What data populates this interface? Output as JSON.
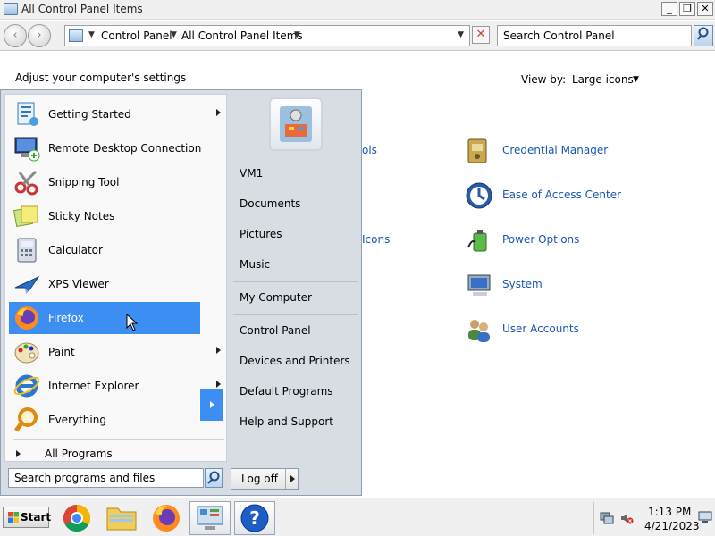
{
  "window": {
    "title": "All Control Panel Items",
    "min_glyph": "_",
    "max_glyph": "❐",
    "close_glyph": "✕"
  },
  "address_bar": {
    "back_glyph": "‹",
    "forward_glyph": "›",
    "breadcrumbs": [
      "Control Panel",
      "All Control Panel Items"
    ],
    "refresh_glyph": "✕",
    "search_placeholder": "Search Control Panel"
  },
  "content": {
    "heading": "Adjust your computer's settings",
    "view_by_label": "View by:",
    "view_by_value": "Large icons",
    "partial_items": [
      "ols",
      "Icons"
    ],
    "items": [
      {
        "label": "Credential Manager",
        "icon": "credential-manager-icon"
      },
      {
        "label": "Ease of Access Center",
        "icon": "ease-of-access-icon"
      },
      {
        "label": "Power Options",
        "icon": "power-options-icon"
      },
      {
        "label": "System",
        "icon": "system-icon"
      },
      {
        "label": "User Accounts",
        "icon": "user-accounts-icon"
      }
    ]
  },
  "start_menu": {
    "programs": [
      {
        "label": "Getting Started",
        "icon": "getting-started-icon",
        "submenu": true
      },
      {
        "label": "Remote Desktop Connection",
        "icon": "remote-desktop-icon",
        "submenu": false
      },
      {
        "label": "Snipping Tool",
        "icon": "snipping-tool-icon",
        "submenu": false
      },
      {
        "label": "Sticky Notes",
        "icon": "sticky-notes-icon",
        "submenu": false
      },
      {
        "label": "Calculator",
        "icon": "calculator-icon",
        "submenu": false
      },
      {
        "label": "XPS Viewer",
        "icon": "xps-viewer-icon",
        "submenu": false
      },
      {
        "label": "Firefox",
        "icon": "firefox-icon",
        "submenu": true,
        "selected": true
      },
      {
        "label": "Paint",
        "icon": "paint-icon",
        "submenu": true
      },
      {
        "label": "Internet Explorer",
        "icon": "internet-explorer-icon",
        "submenu": true
      },
      {
        "label": "Everything",
        "icon": "everything-icon",
        "submenu": false
      }
    ],
    "all_programs": "All Programs",
    "search_placeholder": "Search programs and files",
    "right_items": [
      "VM1",
      "Documents",
      "Pictures",
      "Music",
      "My Computer",
      "Control Panel",
      "Devices and Printers",
      "Default Programs",
      "Help and Support"
    ],
    "log_off": "Log off"
  },
  "taskbar": {
    "start_label": "Start",
    "apps": [
      "chrome-icon",
      "file-explorer-icon",
      "firefox-icon",
      "control-panel-icon",
      "help-icon"
    ],
    "help_glyph": "?",
    "time": "1:13 PM",
    "date": "4/21/2023"
  },
  "colors": {
    "link": "#1a56b0",
    "selection": "#3c8ef2",
    "start_menu_frame": "#d8dde4"
  }
}
